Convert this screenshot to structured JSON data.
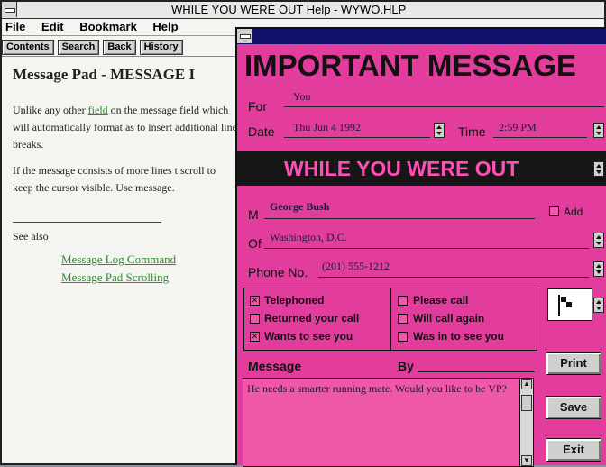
{
  "help_window": {
    "title": "WHILE YOU WERE OUT Help - WYWO.HLP",
    "menu": [
      "File",
      "Edit",
      "Bookmark",
      "Help"
    ],
    "toolbar": [
      "Contents",
      "Search",
      "Back",
      "History"
    ],
    "heading": "Message Pad - MESSAGE I",
    "para1_before_link": "Unlike any other ",
    "para1_link": "field",
    "para1_after_link": " on the message field which will automatically format as to insert additional line breaks.",
    "para2": "If the message consists of more lines t scroll to keep the cursor visible. Use message.",
    "see_also": "See also",
    "see_also_links": [
      "Message Log Command",
      "Message Pad Scrolling"
    ]
  },
  "message_pad": {
    "heading": "IMPORTANT MESSAGE",
    "for_label": "For",
    "for_value": "You",
    "date_label": "Date",
    "date_value": "Thu Jun 4 1992",
    "time_label": "Time",
    "time_value": "2:59 PM",
    "banner": "WHILE YOU WERE OUT",
    "m_label": "M",
    "m_value": "George Bush",
    "add_label": "Add",
    "of_label": "Of",
    "of_value": "Washington, D.C.",
    "phone_label": "Phone No.",
    "phone_value": "(201) 555-1212",
    "checks_left": [
      {
        "label": "Telephoned",
        "checked": true
      },
      {
        "label": "Returned your call",
        "checked": false
      },
      {
        "label": "Wants to see you",
        "checked": true
      }
    ],
    "checks_right": [
      {
        "label": "Please call",
        "checked": false
      },
      {
        "label": "Will call again",
        "checked": false
      },
      {
        "label": "Was in to see you",
        "checked": false
      }
    ],
    "message_label": "Message",
    "by_label": "By",
    "message_text": "He needs a smarter running mate. Would you like to be VP?",
    "buttons": {
      "print": "Print",
      "save": "Save",
      "exit": "Exit"
    },
    "colors": {
      "pad_background": "#e23d9c",
      "banner_background": "#161616",
      "banner_text": "#ff4fb5"
    }
  }
}
